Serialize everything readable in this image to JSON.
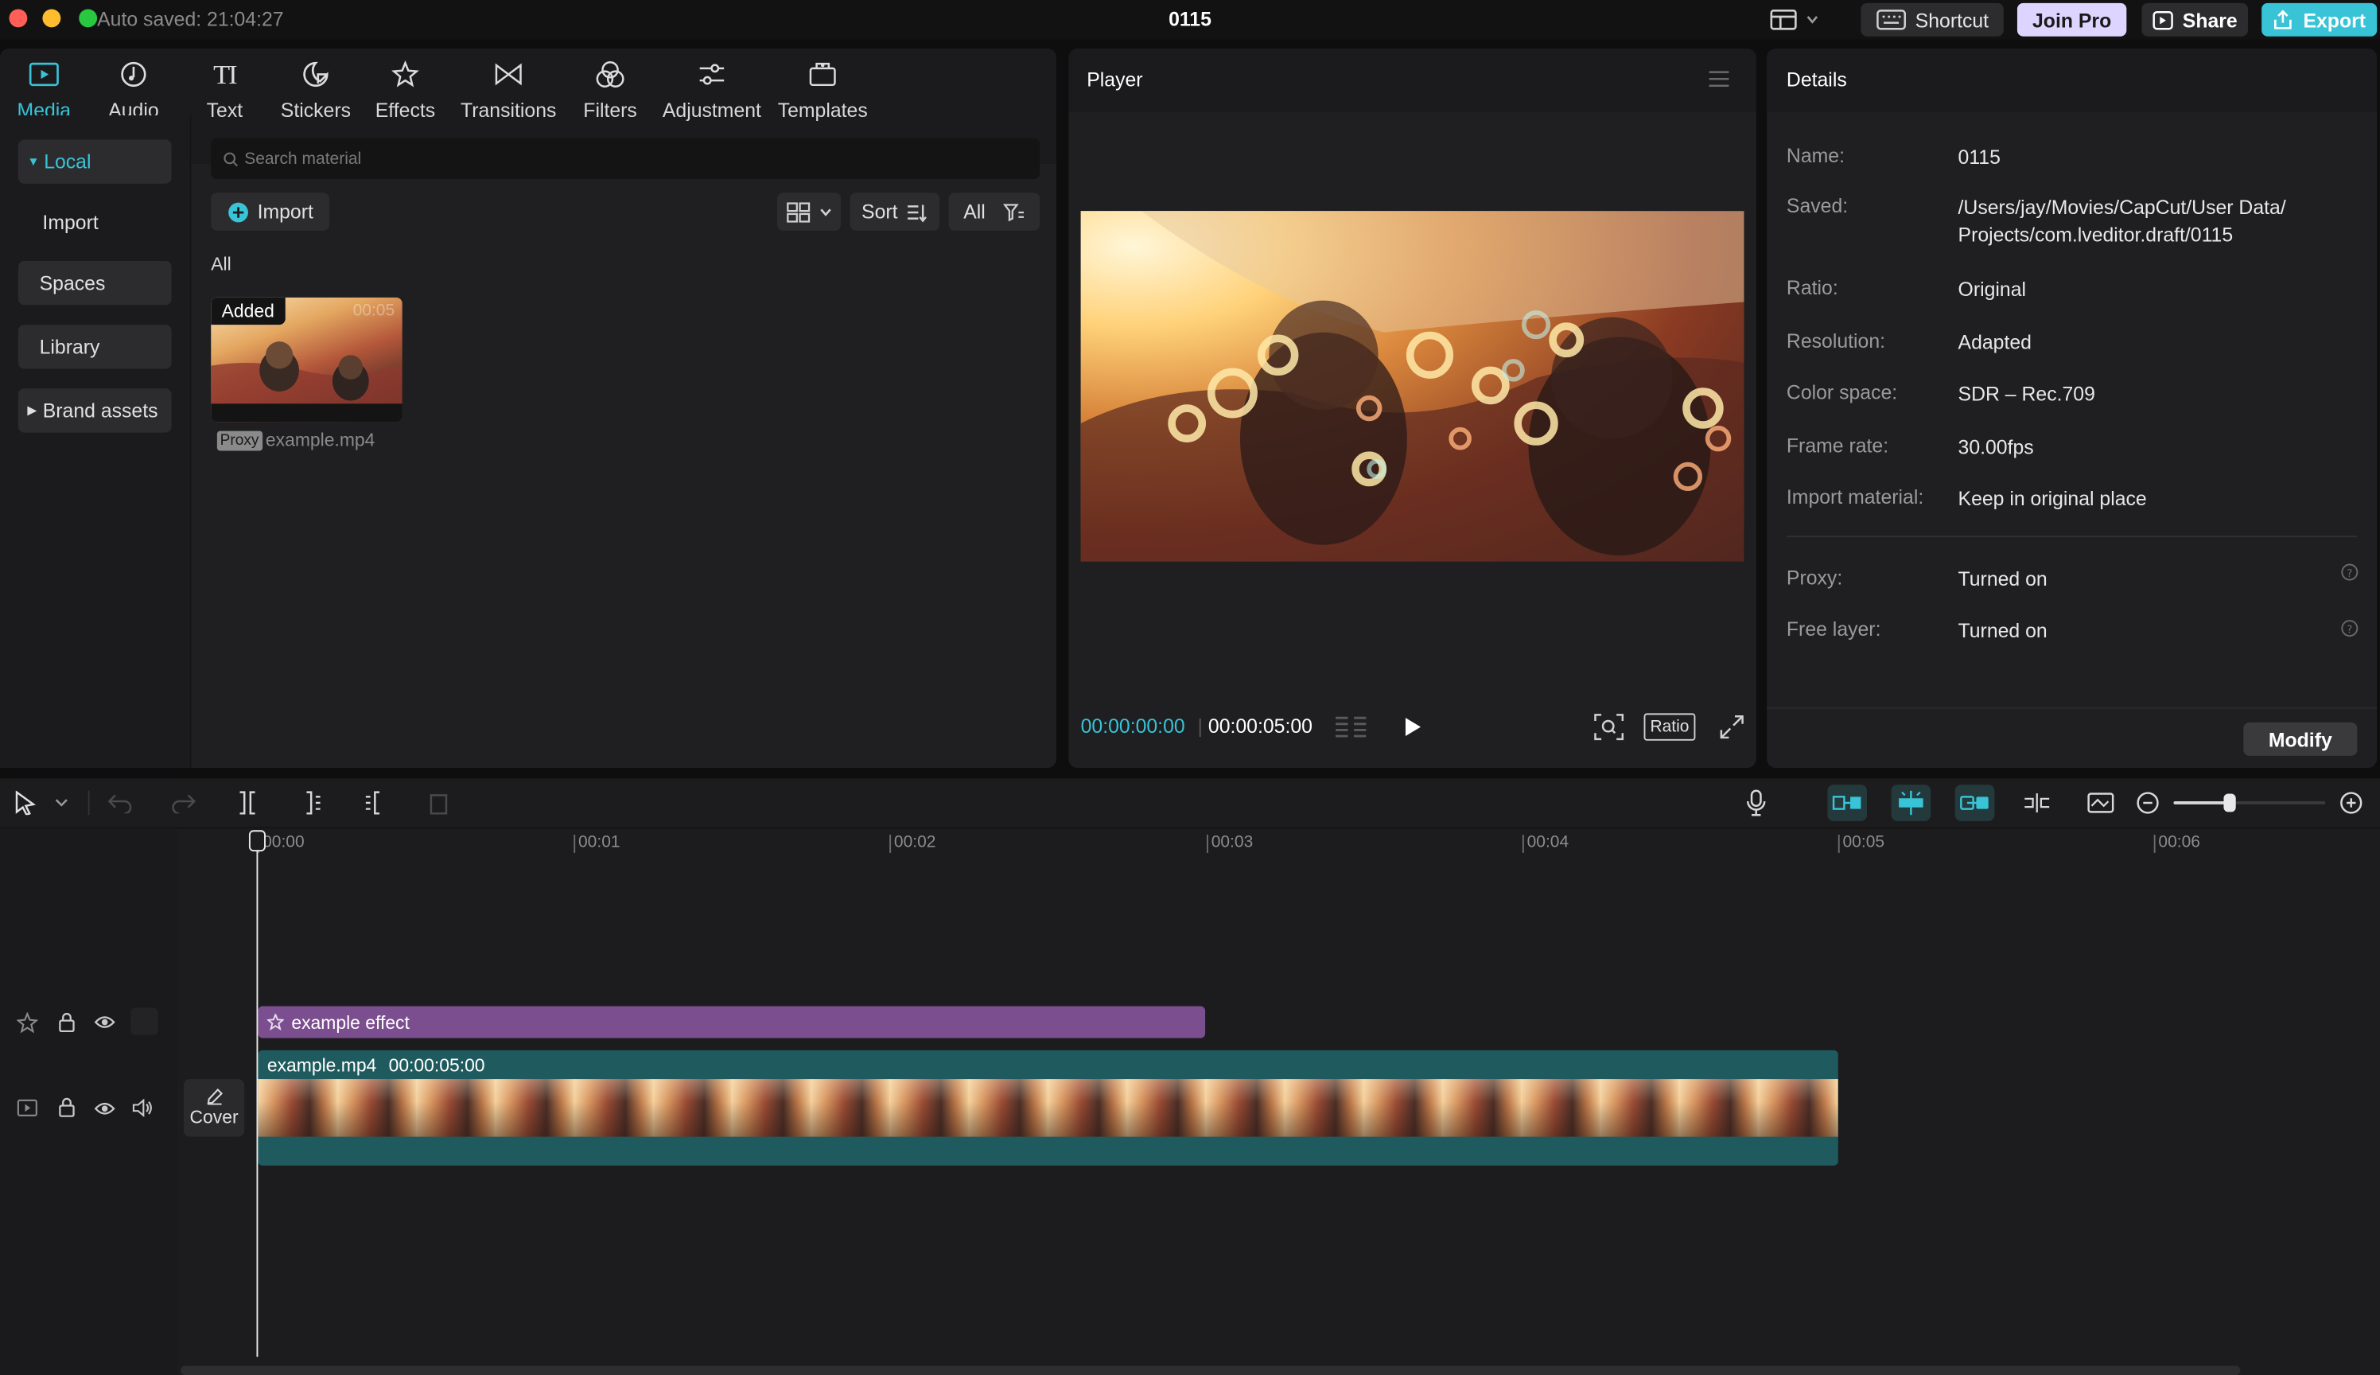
{
  "titlebar": {
    "auto_saved": "Auto saved: 21:04:27",
    "title": "0115",
    "shortcut": "Shortcut",
    "join_pro": "Join Pro",
    "share": "Share",
    "export": "Export"
  },
  "tabs": [
    {
      "label": "Media",
      "icon": "media-icon"
    },
    {
      "label": "Audio",
      "icon": "audio-icon"
    },
    {
      "label": "Text",
      "icon": "text-icon"
    },
    {
      "label": "Stickers",
      "icon": "stickers-icon"
    },
    {
      "label": "Effects",
      "icon": "effects-icon"
    },
    {
      "label": "Transitions",
      "icon": "transitions-icon"
    },
    {
      "label": "Filters",
      "icon": "filters-icon"
    },
    {
      "label": "Adjustment",
      "icon": "adjustment-icon"
    },
    {
      "label": "Templates",
      "icon": "templates-icon"
    }
  ],
  "sidebar": {
    "local": "Local",
    "import": "Import",
    "spaces": "Spaces",
    "library": "Library",
    "brand_assets": "Brand assets"
  },
  "media": {
    "search_placeholder": "Search material",
    "import_label": "Import",
    "sort_label": "Sort",
    "all_filter": "All",
    "section_all": "All",
    "clip": {
      "added_badge": "Added",
      "duration": "00:05",
      "proxy_badge": "Proxy",
      "filename": "example.mp4"
    }
  },
  "player": {
    "title": "Player",
    "current_time": "00:00:00:00",
    "total_time": "00:00:05:00",
    "ratio_label": "Ratio"
  },
  "details": {
    "title": "Details",
    "rows": [
      {
        "key": "Name:",
        "value": "0115"
      },
      {
        "key": "Saved:",
        "value": "/Users/jay/Movies/CapCut/User Data/",
        "value2": "Projects/com.lveditor.draft/0115"
      },
      {
        "key": "Ratio:",
        "value": "Original"
      },
      {
        "key": "Resolution:",
        "value": "Adapted"
      },
      {
        "key": "Color space:",
        "value": "SDR – Rec.709"
      },
      {
        "key": "Frame rate:",
        "value": "30.00fps"
      },
      {
        "key": "Import material:",
        "value": "Keep in original place"
      },
      {
        "key": "Proxy:",
        "value": "Turned on"
      },
      {
        "key": "Free layer:",
        "value": "Turned on"
      }
    ],
    "modify_label": "Modify"
  },
  "timeline": {
    "ruler": [
      "00:00",
      "00:01",
      "00:02",
      "00:03",
      "00:04",
      "00:05",
      "00:06"
    ],
    "effect_clip": "example effect",
    "video_clip_name": "example.mp4",
    "video_clip_duration": "00:00:05:00",
    "cover_label": "Cover",
    "zoom_level": 0.37
  },
  "colors": {
    "accent": "#38c3d6",
    "effect_track": "#7b4f8f",
    "video_track": "#1f5b5e",
    "join_pro": "#ddd5ff",
    "export": "#38c3d6"
  }
}
